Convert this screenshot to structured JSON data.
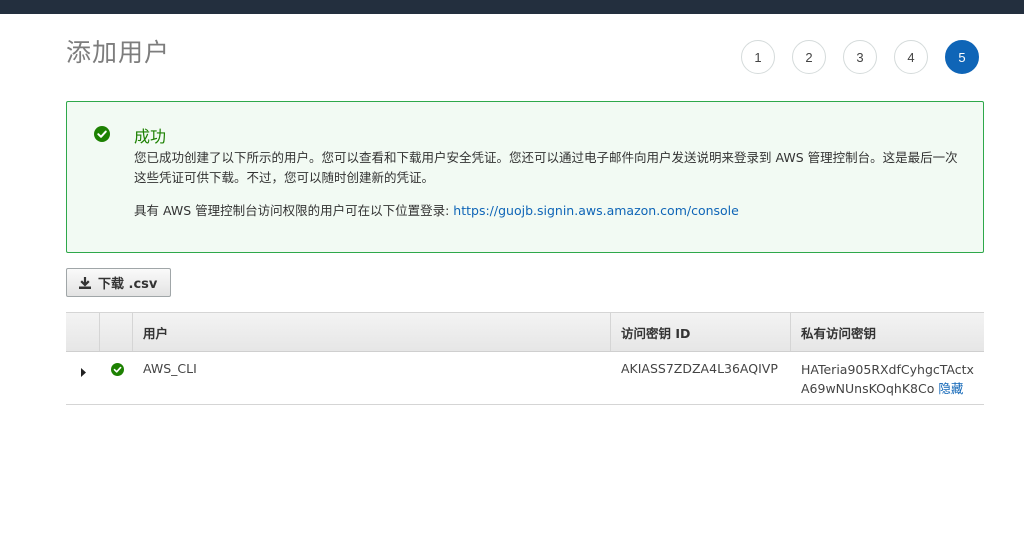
{
  "page": {
    "title": "添加用户"
  },
  "steps": [
    "1",
    "2",
    "3",
    "4",
    "5"
  ],
  "active_step": "5",
  "alert": {
    "title": "成功",
    "message": "您已成功创建了以下所示的用户。您可以查看和下载用户安全凭证。您还可以通过电子邮件向用户发送说明来登录到 AWS 管理控制台。这是最后一次这些凭证可供下载。不过，您可以随时创建新的凭证。",
    "console_prefix": "具有 AWS 管理控制台访问权限的用户可在以下位置登录: ",
    "console_url": "https://guojb.signin.aws.amazon.com/console"
  },
  "toolbar": {
    "download_csv_label": "下载 .csv"
  },
  "table": {
    "headers": {
      "user": "用户",
      "access_key_id": "访问密钥 ID",
      "secret_key": "私有访问密钥"
    },
    "rows": [
      {
        "user": "AWS_CLI",
        "access_key_id": "AKIASS7ZDZA4L36AQIVP",
        "secret_line1": "HATeria905RXdfCyhgcTActx",
        "secret_line2": "A69wNUnsKOqhK8Co",
        "hide_label": "隐藏"
      }
    ]
  },
  "colors": {
    "accent": "#0f65b7",
    "success": "#1d8102",
    "success_border": "#2ea84a",
    "topbar": "#232f3e"
  }
}
